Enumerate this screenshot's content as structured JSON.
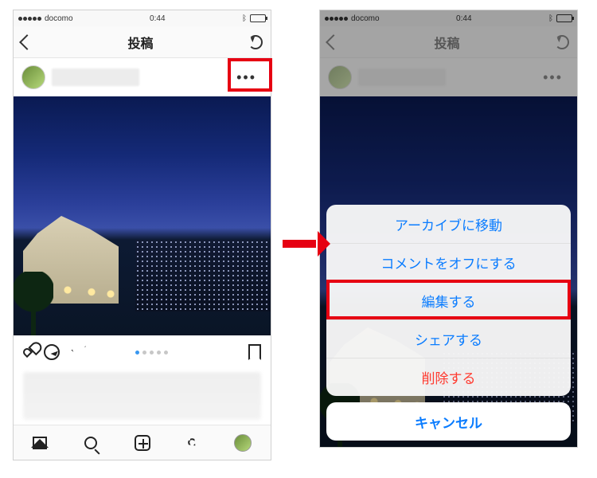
{
  "status": {
    "carrier": "docomo",
    "time": "0:44"
  },
  "nav": {
    "title": "投稿"
  },
  "actionRow": {
    "dotsCount": 5,
    "activeDot": 0
  },
  "sheet": {
    "archive": "アーカイブに移動",
    "commentsOff": "コメントをオフにする",
    "edit": "編集する",
    "share": "シェアする",
    "delete": "削除する",
    "cancel": "キャンセル"
  }
}
